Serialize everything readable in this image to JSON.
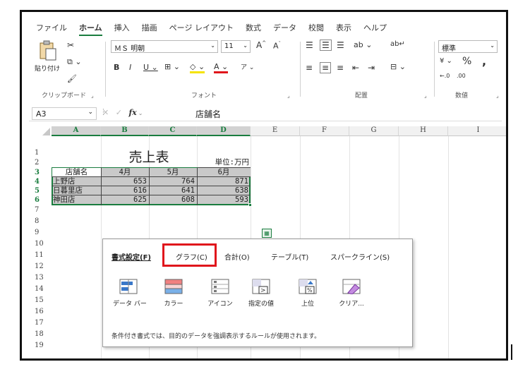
{
  "ribbon_tabs": [
    "ファイル",
    "ホーム",
    "挿入",
    "描画",
    "ページ レイアウト",
    "数式",
    "データ",
    "校閲",
    "表示",
    "ヘルプ"
  ],
  "active_tab": "ホーム",
  "clipboard": {
    "paste_label": "貼り付け",
    "group_label": "クリップボード"
  },
  "font": {
    "name": "ＭＳ 明朝",
    "size": "11",
    "group_label": "フォント"
  },
  "alignment": {
    "group_label": "配置"
  },
  "number": {
    "format": "標準",
    "group_label": "数値"
  },
  "formula_bar": {
    "name_box": "A3",
    "fx": "fx",
    "content": "店舗名"
  },
  "columns": [
    "A",
    "B",
    "C",
    "D",
    "E",
    "F",
    "G",
    "H",
    "I"
  ],
  "rows": [
    "1",
    "2",
    "3",
    "4",
    "5",
    "6",
    "7",
    "8",
    "9",
    "10",
    "11",
    "12",
    "13",
    "14",
    "15",
    "16",
    "17",
    "18",
    "19"
  ],
  "sheet": {
    "title": "売上表",
    "unit": "単位:万円",
    "headers": [
      "店舗名",
      "4月",
      "5月",
      "6月"
    ],
    "data": [
      [
        "上野店",
        "653",
        "764",
        "871"
      ],
      [
        "日暮里店",
        "616",
        "641",
        "638"
      ],
      [
        "神田店",
        "625",
        "608",
        "593"
      ]
    ]
  },
  "quick_analysis": {
    "tabs": [
      "書式設定(F)",
      "グラフ(C)",
      "合計(O)",
      "テーブル(T)",
      "スパークライン(S)"
    ],
    "active_tab": "書式設定(F)",
    "highlighted_tab": "グラフ(C)",
    "options": [
      "データ バー",
      "カラー",
      "アイコン",
      "指定の値",
      "上位",
      "クリア..."
    ],
    "description": "条件付き書式では、目的のデータを強調表示するルールが使用されます。"
  },
  "colors": {
    "accent": "#1a7d3f",
    "highlight": "#e0161c",
    "selection": "#c9c9c9"
  }
}
